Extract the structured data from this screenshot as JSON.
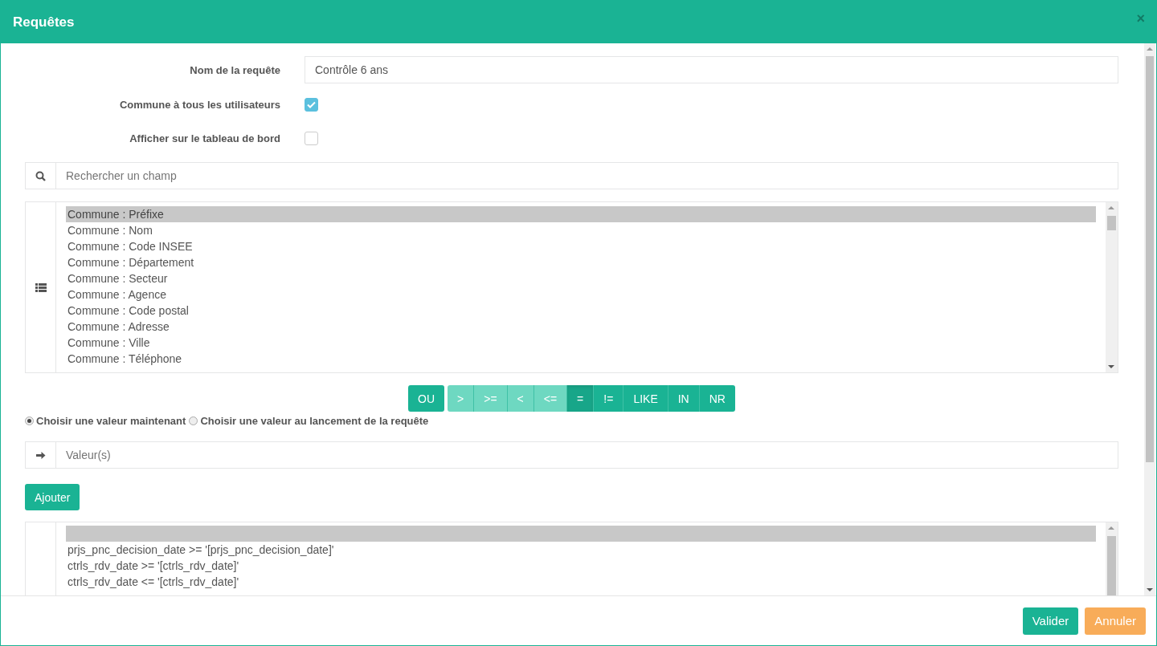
{
  "window": {
    "title": "Requêtes",
    "close": "×"
  },
  "form": {
    "name_label": "Nom de la requête",
    "name_value": "Contrôle 6 ans",
    "options": [
      {
        "label": "Commune à tous les utilisateurs",
        "checked": true
      },
      {
        "label": "Afficher sur le tableau de bord",
        "checked": false
      }
    ]
  },
  "field_search": {
    "placeholder": "Rechercher un champ"
  },
  "fields": [
    {
      "text": "Commune : Préfixe",
      "selected": true
    },
    {
      "text": "Commune : Nom",
      "selected": false
    },
    {
      "text": "Commune : Code INSEE",
      "selected": false
    },
    {
      "text": "Commune : Département",
      "selected": false
    },
    {
      "text": "Commune : Secteur",
      "selected": false
    },
    {
      "text": "Commune : Agence",
      "selected": false
    },
    {
      "text": "Commune : Code postal",
      "selected": false
    },
    {
      "text": "Commune : Adresse",
      "selected": false
    },
    {
      "text": "Commune : Ville",
      "selected": false
    },
    {
      "text": "Commune : Téléphone",
      "selected": false
    }
  ],
  "or_button": "OU",
  "operators": [
    {
      "label": ">",
      "disabled": true,
      "selected": false
    },
    {
      "label": ">=",
      "disabled": true,
      "selected": false
    },
    {
      "label": "<",
      "disabled": true,
      "selected": false
    },
    {
      "label": "<=",
      "disabled": true,
      "selected": false
    },
    {
      "label": "=",
      "disabled": false,
      "selected": true
    },
    {
      "label": "!=",
      "disabled": false,
      "selected": false
    },
    {
      "label": "LIKE",
      "disabled": false,
      "selected": false
    },
    {
      "label": "IN",
      "disabled": false,
      "selected": false
    },
    {
      "label": "NR",
      "disabled": false,
      "selected": false
    }
  ],
  "value_modes": [
    {
      "label": "Choisir une valeur maintenant",
      "selected": true
    },
    {
      "label": "Choisir une valeur au lancement de la requête",
      "selected": false
    }
  ],
  "value_field": {
    "placeholder": "Valeur(s)"
  },
  "add_button": "Ajouter",
  "conditions": [
    {
      "selected": true
    },
    {
      "text": "prjs_pnc_decision_date >= '[prjs_pnc_decision_date]'",
      "selected": false
    },
    {
      "text": "ctrls_rdv_date >= '[ctrls_rdv_date]'",
      "selected": false
    },
    {
      "text": "ctrls_rdv_date <= '[ctrls_rdv_date]'",
      "selected": false
    }
  ],
  "footer": {
    "buttons": [
      {
        "label": "Valider",
        "kind": "primary"
      },
      {
        "label": "Annuler",
        "kind": "warning"
      }
    ]
  }
}
